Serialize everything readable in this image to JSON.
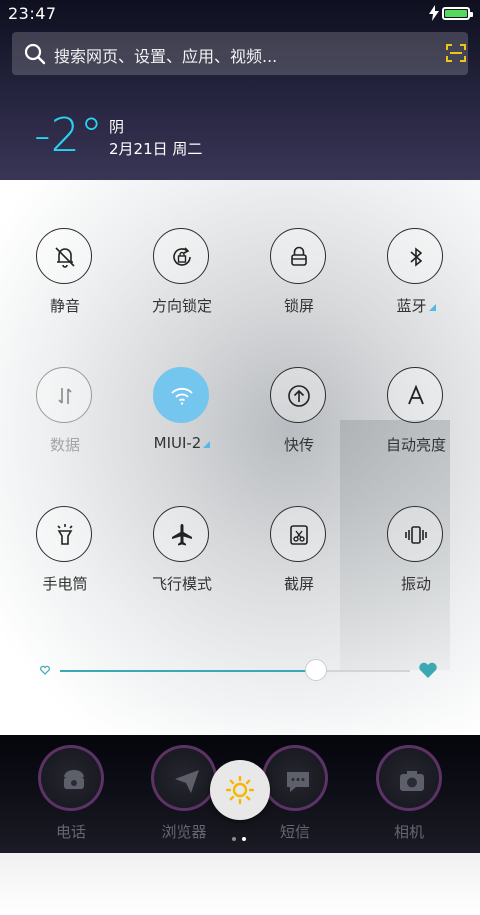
{
  "status_bar": {
    "time": "23:47"
  },
  "search": {
    "placeholder": "搜索网页、设置、应用、视频..."
  },
  "weather": {
    "temperature": "-2°",
    "condition": "阴",
    "date": "2月21日 周二"
  },
  "toggles": [
    {
      "label": "静音",
      "icon": "bell-off-icon",
      "state": "on"
    },
    {
      "label": "方向锁定",
      "icon": "rotation-lock-icon",
      "state": "on"
    },
    {
      "label": "锁屏",
      "icon": "lock-icon",
      "state": "on"
    },
    {
      "label": "蓝牙",
      "icon": "bluetooth-icon",
      "state": "on",
      "has_more": true
    },
    {
      "label": "数据",
      "icon": "data-arrows-icon",
      "state": "disabled"
    },
    {
      "label": "MIUI-2",
      "icon": "wifi-icon",
      "state": "active",
      "has_more": true
    },
    {
      "label": "快传",
      "icon": "upload-circle-icon",
      "state": "on"
    },
    {
      "label": "自动亮度",
      "icon": "auto-brightness-icon",
      "state": "on"
    },
    {
      "label": "手电筒",
      "icon": "flashlight-icon",
      "state": "on"
    },
    {
      "label": "飞行模式",
      "icon": "airplane-icon",
      "state": "on"
    },
    {
      "label": "截屏",
      "icon": "screenshot-icon",
      "state": "on"
    },
    {
      "label": "振动",
      "icon": "vibrate-icon",
      "state": "on"
    }
  ],
  "brightness": {
    "level": 0.73
  },
  "dock": [
    {
      "label": "电话",
      "icon": "phone-icon"
    },
    {
      "label": "浏览器",
      "icon": "browser-icon"
    },
    {
      "label": "短信",
      "icon": "message-icon"
    },
    {
      "label": "相机",
      "icon": "camera-icon"
    }
  ],
  "colors": {
    "accent": "#75c6ef",
    "temperature": "#28d4f0",
    "slider": "#3aa9b3",
    "battery": "#53d95c"
  }
}
